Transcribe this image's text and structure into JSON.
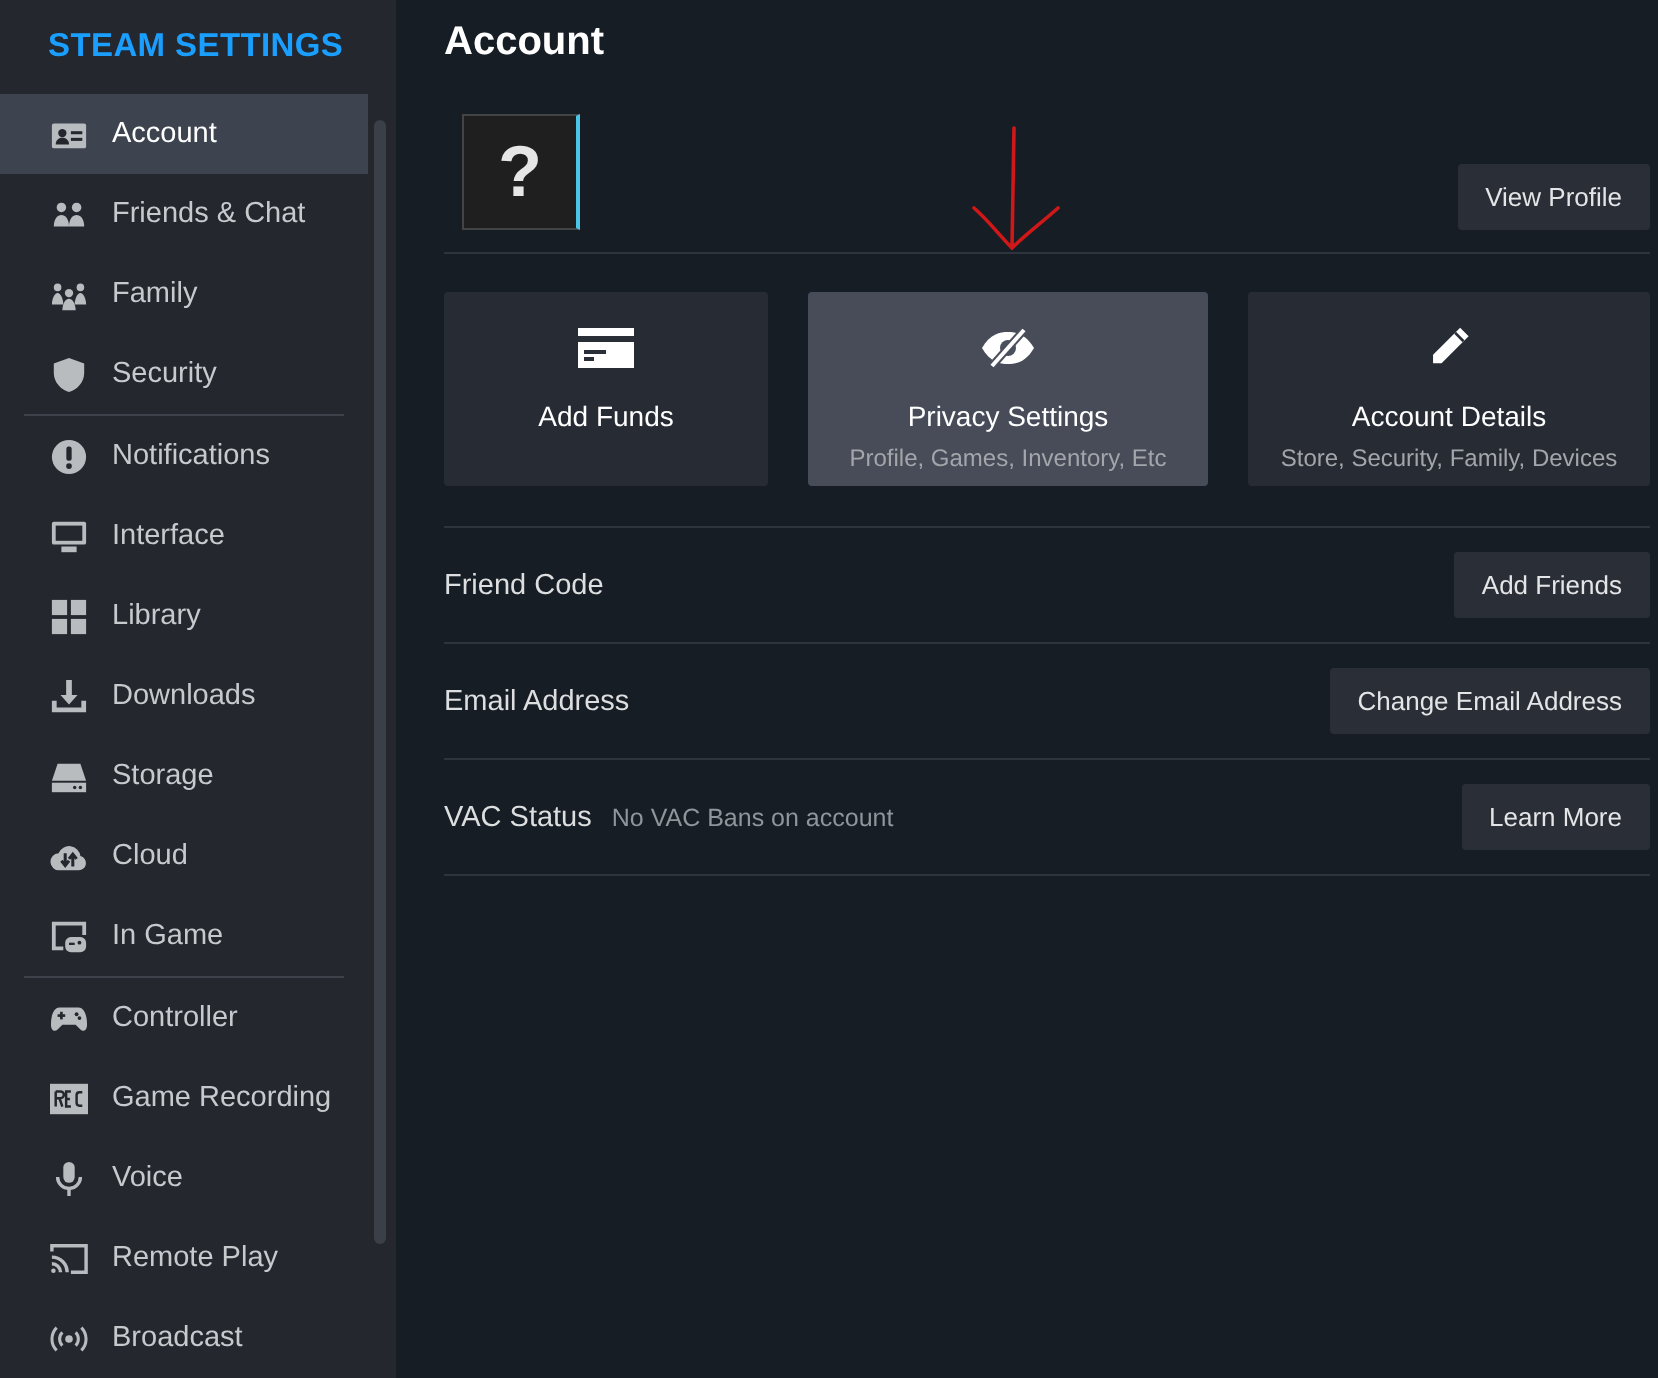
{
  "sidebar": {
    "title": "STEAM SETTINGS",
    "groups": [
      {
        "items": [
          {
            "label": "Account",
            "selected": true
          },
          {
            "label": "Friends & Chat",
            "selected": false
          },
          {
            "label": "Family",
            "selected": false
          },
          {
            "label": "Security",
            "selected": false
          }
        ]
      },
      {
        "items": [
          {
            "label": "Notifications",
            "selected": false
          },
          {
            "label": "Interface",
            "selected": false
          },
          {
            "label": "Library",
            "selected": false
          },
          {
            "label": "Downloads",
            "selected": false
          },
          {
            "label": "Storage",
            "selected": false
          },
          {
            "label": "Cloud",
            "selected": false
          },
          {
            "label": "In Game",
            "selected": false
          }
        ]
      },
      {
        "items": [
          {
            "label": "Controller",
            "selected": false
          },
          {
            "label": "Game Recording",
            "selected": false
          },
          {
            "label": "Voice",
            "selected": false
          },
          {
            "label": "Remote Play",
            "selected": false
          },
          {
            "label": "Broadcast",
            "selected": false
          }
        ]
      }
    ]
  },
  "page": {
    "title": "Account",
    "avatar": {
      "placeholder": "?"
    },
    "view_profile_button": "View Profile",
    "cards": [
      {
        "title": "Add Funds",
        "selected": false
      },
      {
        "title": "Privacy Settings",
        "subtitle": "Profile, Games, Inventory, Etc",
        "selected": true
      },
      {
        "title": "Account Details",
        "subtitle": "Store, Security, Family, Devices",
        "selected": false
      }
    ],
    "rows": [
      {
        "label": "Friend Code",
        "button": "Add Friends"
      },
      {
        "label": "Email Address",
        "button": "Change Email Address"
      },
      {
        "label": "VAC Status",
        "detail": "No VAC Bans on account",
        "button": "Learn More"
      }
    ]
  }
}
